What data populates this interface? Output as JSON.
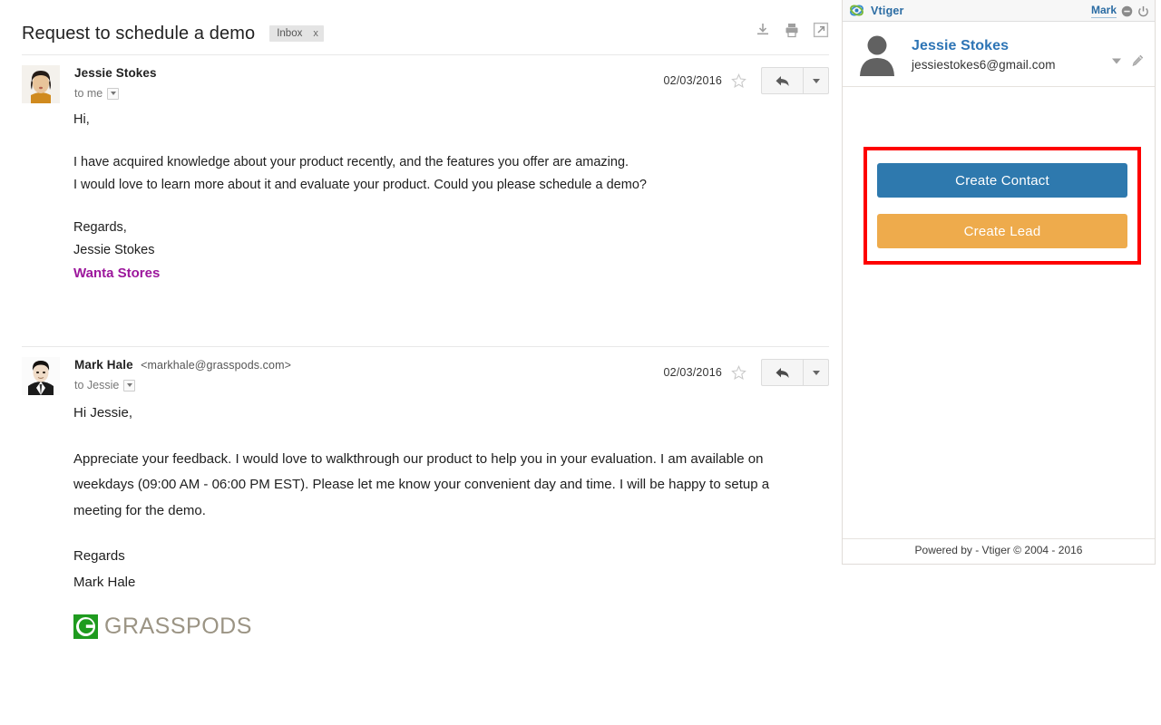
{
  "mail": {
    "subject": "Request to schedule a demo",
    "label": "Inbox",
    "label_remove": "x",
    "actions": [
      {
        "name": "download-icon",
        "title": "Download"
      },
      {
        "name": "print-icon",
        "title": "Print"
      },
      {
        "name": "open-in-new-window-icon",
        "title": "Open in new window"
      }
    ],
    "messages": [
      {
        "sender_name": "Jessie Stokes",
        "sender_email": "",
        "recipient": "to me",
        "date": "02/03/2016",
        "body": {
          "greeting": "Hi,",
          "para1_line1": "I have acquired knowledge about your product recently, and the features you offer are amazing.",
          "para1_line2": "I would love to learn more about it and evaluate your product. Could you please schedule a demo?",
          "signoff": "Regards,",
          "signer": "Jessie Stokes",
          "company": "Wanta Stores"
        }
      },
      {
        "sender_name": "Mark Hale",
        "sender_email": "<markhale@grasspods.com>",
        "recipient": "to Jessie",
        "date": "02/03/2016",
        "body": {
          "greeting": "Hi Jessie,",
          "para1": "Appreciate your feedback. I would love to walkthrough our product to help you in your evaluation. I am available on weekdays (09:00 AM - 06:00 PM EST). Please let me know your convenient day and time. I will be happy to setup a meeting for the demo.",
          "signoff": "Regards",
          "signer": "Mark Hale",
          "logo_text": "GRASSPODS"
        }
      }
    ]
  },
  "vtiger": {
    "brand": "Vtiger",
    "user": "Mark",
    "contact": {
      "name": "Jessie Stokes",
      "email": "jessiestokes6@gmail.com"
    },
    "buttons": {
      "create_contact": "Create Contact",
      "create_lead": "Create Lead"
    },
    "footer": "Powered by - Vtiger © 2004 - 2016",
    "colors": {
      "brand_blue": "#2b6ca3",
      "contact_button": "#2e79ae",
      "lead_button": "#eeab4c",
      "highlight_border": "#fe0000",
      "company_purple": "#9c179c"
    }
  }
}
